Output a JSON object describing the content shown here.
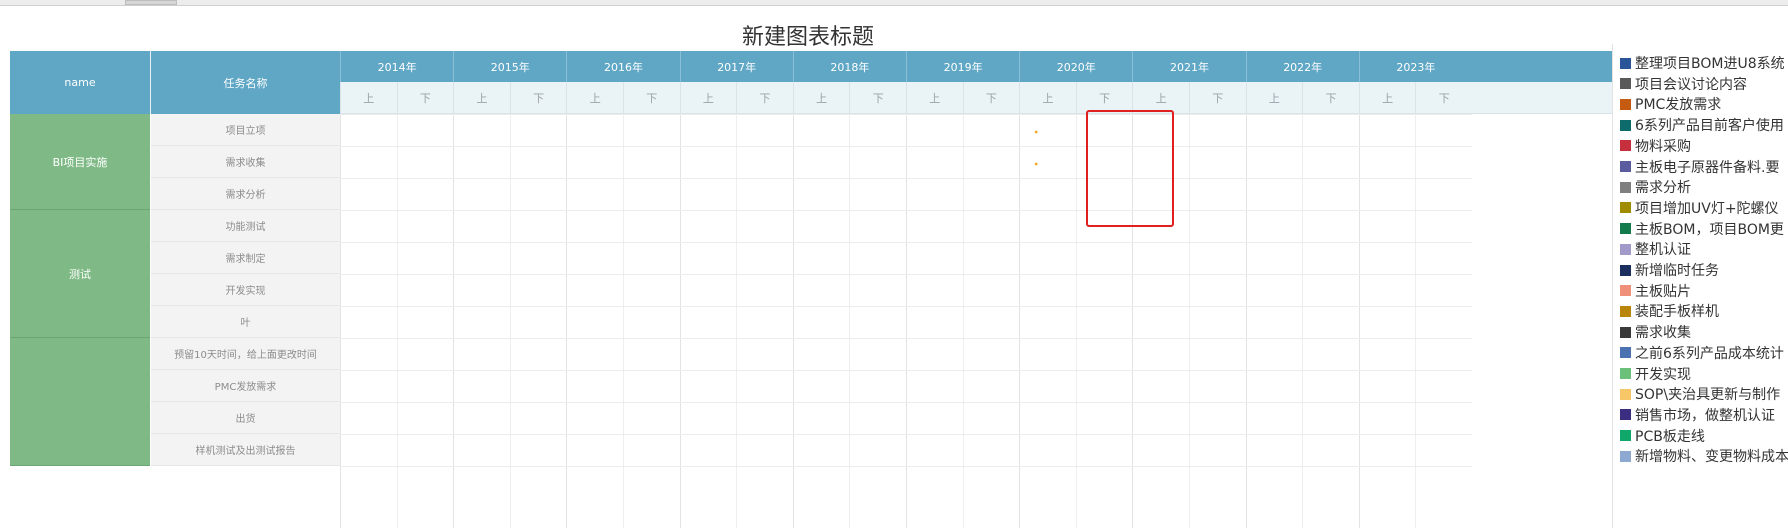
{
  "title": "新建图表标题",
  "header": {
    "name_label": "name",
    "task_label": "任务名称"
  },
  "timeline": {
    "years": [
      "2014年",
      "2015年",
      "2016年",
      "2017年",
      "2018年",
      "2019年",
      "2020年",
      "2021年",
      "2022年",
      "2023年"
    ],
    "halves": [
      "上",
      "下"
    ]
  },
  "colors": {
    "header": "#5fa7c5",
    "group": "#7fba86",
    "task_bg": "#f3f3f3",
    "highlight": "#e02020",
    "marker": "#f5a623"
  },
  "chart_data": {
    "type": "gantt",
    "title": "新建图表标题",
    "x_axis": {
      "years": [
        "2014年",
        "2015年",
        "2016年",
        "2017年",
        "2018年",
        "2019年",
        "2020年",
        "2021年",
        "2022年",
        "2023年"
      ],
      "sub": [
        "上",
        "下"
      ],
      "range": [
        "2014年 上",
        "2023年 下"
      ]
    },
    "groups": [
      {
        "name": "BI项目实施",
        "tasks": [
          "项目立项",
          "需求收集",
          "需求分析"
        ]
      },
      {
        "name": "测试",
        "tasks": [
          "功能测试",
          "需求制定",
          "开发实现",
          "叶"
        ]
      },
      {
        "name": "",
        "tasks": [
          "预留10天时间，给上面更改时间",
          "PMC发放需求",
          "出货",
          "样机测试及出测试报告"
        ]
      }
    ],
    "markers": [
      {
        "task": "项目立项",
        "period": "2020年 上",
        "position": 0.3
      },
      {
        "task": "需求收集",
        "period": "2020年 上",
        "position": 0.3
      }
    ],
    "legend_placement": "right",
    "legend": [
      {
        "name": "整理项目BOM进U8系统",
        "color": "#2a5599"
      },
      {
        "name": "项目会议讨论内容",
        "color": "#595959"
      },
      {
        "name": "PMC发放需求",
        "color": "#c55a11"
      },
      {
        "name": "6系列产品目前客户使用",
        "color": "#0e6b6b"
      },
      {
        "name": "物料采购",
        "color": "#c62f3c"
      },
      {
        "name": "主板电子原器件备料.要",
        "color": "#5b5b9f"
      },
      {
        "name": "需求分析",
        "color": "#7f7f7f"
      },
      {
        "name": "项目增加UV灯+陀螺仪",
        "color": "#a08c00"
      },
      {
        "name": "主板BOM，项目BOM更",
        "color": "#127a4b"
      },
      {
        "name": "整机认证",
        "color": "#a29ac8"
      },
      {
        "name": "新增临时任务",
        "color": "#1b2f5e"
      },
      {
        "name": "主板贴片",
        "color": "#f08f7a"
      },
      {
        "name": "装配手板样机",
        "color": "#b8860b"
      },
      {
        "name": "需求收集",
        "color": "#3a3a3a"
      },
      {
        "name": "之前6系列产品成本统计",
        "color": "#4a72b0"
      },
      {
        "name": "开发实现",
        "color": "#6cc17a"
      },
      {
        "name": "SOP\\夹治具更新与制作",
        "color": "#f6c667"
      },
      {
        "name": "销售市场，做整机认证",
        "color": "#3b2d80"
      },
      {
        "name": "PCB板走线",
        "color": "#10a86a"
      },
      {
        "name": "新增物料、变更物料成本",
        "color": "#8ea9d1"
      }
    ]
  }
}
